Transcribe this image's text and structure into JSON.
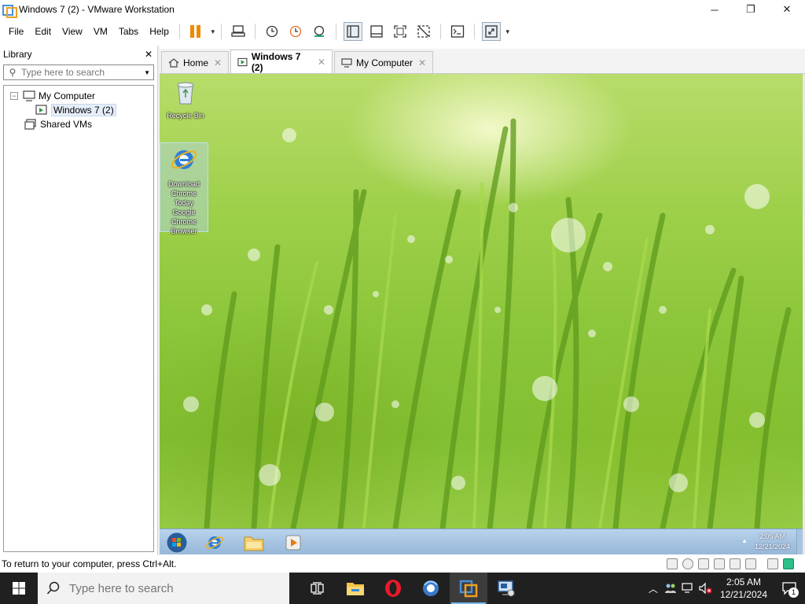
{
  "window": {
    "title": "Windows 7 (2) - VMware Workstation",
    "controls": {
      "minimize": "─",
      "maximize": "❐",
      "close": "✕"
    }
  },
  "menu": {
    "items": [
      "File",
      "Edit",
      "View",
      "VM",
      "Tabs",
      "Help"
    ]
  },
  "library": {
    "title": "Library",
    "close": "✕",
    "search_placeholder": "Type here to search",
    "tree": {
      "root": "My Computer",
      "root_toggle": "−",
      "child": "Windows 7 (2)",
      "shared": "Shared VMs"
    }
  },
  "tabs": [
    {
      "label": "Home",
      "close": "✕"
    },
    {
      "label": "Windows 7 (2)",
      "close": "✕",
      "active": true
    },
    {
      "label": "My Computer",
      "close": "✕"
    }
  ],
  "vm": {
    "desktop_icons": {
      "recycle_bin": "Recycle Bin",
      "download_chrome": "Download Chrome Today Google Chrome Browser"
    },
    "clock": {
      "time": "2:05 AM",
      "date": "12/21/2024"
    },
    "tray_arrow": "▲"
  },
  "status": {
    "text": "To return to your computer, press Ctrl+Alt."
  },
  "host_taskbar": {
    "search_placeholder": "Type here to search",
    "clock": {
      "time": "2:05 AM",
      "date": "12/21/2024"
    },
    "notification_count": "1",
    "tray_up": "︿"
  },
  "colors": {
    "pause_accent": "#f08a00",
    "taskbar_bg": "#202020",
    "active_indicator": "#76b9ed"
  }
}
